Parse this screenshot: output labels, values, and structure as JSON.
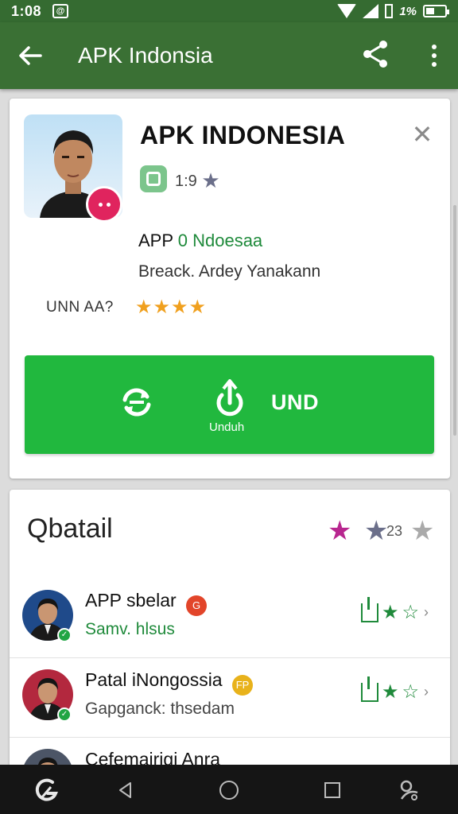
{
  "status_bar": {
    "time": "1:08",
    "notification_icon": "@",
    "battery_text": "1%"
  },
  "app_bar": {
    "title": "APK Indonsia"
  },
  "app_card": {
    "title": "APK INDONESIA",
    "rating_value": "1:9",
    "subtitle_prefix": "APP",
    "subtitle_name": "0 Ndoesaa",
    "developer": "Breack. Ardey Yanakann",
    "meta_label": "UNN AA?",
    "star_rating": 4,
    "star_count": 4,
    "install_button": {
      "sub_label": "Unduh",
      "label": "UND"
    }
  },
  "detail_card": {
    "title": "Qbatail",
    "rating_text": "23",
    "items": [
      {
        "name": "APP sbelar",
        "badge": "G",
        "badge_color": "#e2452a",
        "subtitle": "Samv. hlsus",
        "subtitle_color": "#1f8a3b",
        "avatar_bg": "#1f4a8a",
        "stars": 2
      },
      {
        "name": "Patal iNongossia",
        "badge": "FP",
        "badge_color": "#e8b21b",
        "subtitle": "Gapganck: thsedam",
        "subtitle_color": "#444444",
        "avatar_bg": "#b3283e",
        "stars": 2
      },
      {
        "name": "Cefemairigi Anra",
        "badge": "",
        "badge_color": "#ffffff",
        "subtitle": "",
        "subtitle_color": "#444444",
        "avatar_bg": "#4c5566",
        "stars": 0
      }
    ]
  },
  "colors": {
    "app_bar": "#3a7034",
    "status_bar": "#356b31",
    "install_button": "#21b83e",
    "star_orange": "#f0a01e",
    "star_magenta": "#b8268f"
  }
}
